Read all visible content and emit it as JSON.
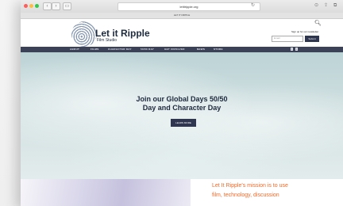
{
  "browser": {
    "url": "letitripple.org",
    "tab_title": "LET IT RIPPLE"
  },
  "site": {
    "logo_title": "Let it Ripple",
    "logo_subtitle": "Film Studio",
    "newsletter_label": "Sign up for our newsletter",
    "email_placeholder": "Email",
    "submit_label": "Submit"
  },
  "nav": {
    "items": [
      "ABOUT",
      "FILMS",
      "CHARACTER DAY",
      "50/50 DAY",
      "GET INVOLVED",
      "NEWS",
      "STORE"
    ]
  },
  "hero": {
    "title_line1": "Join our Global Days 50/50",
    "title_line2": "Day and Character Day",
    "button_label": "LEARN MORE"
  },
  "mission": {
    "line1": "Let It Ripple's mission is to use",
    "line2": "film, technology, discussion"
  }
}
